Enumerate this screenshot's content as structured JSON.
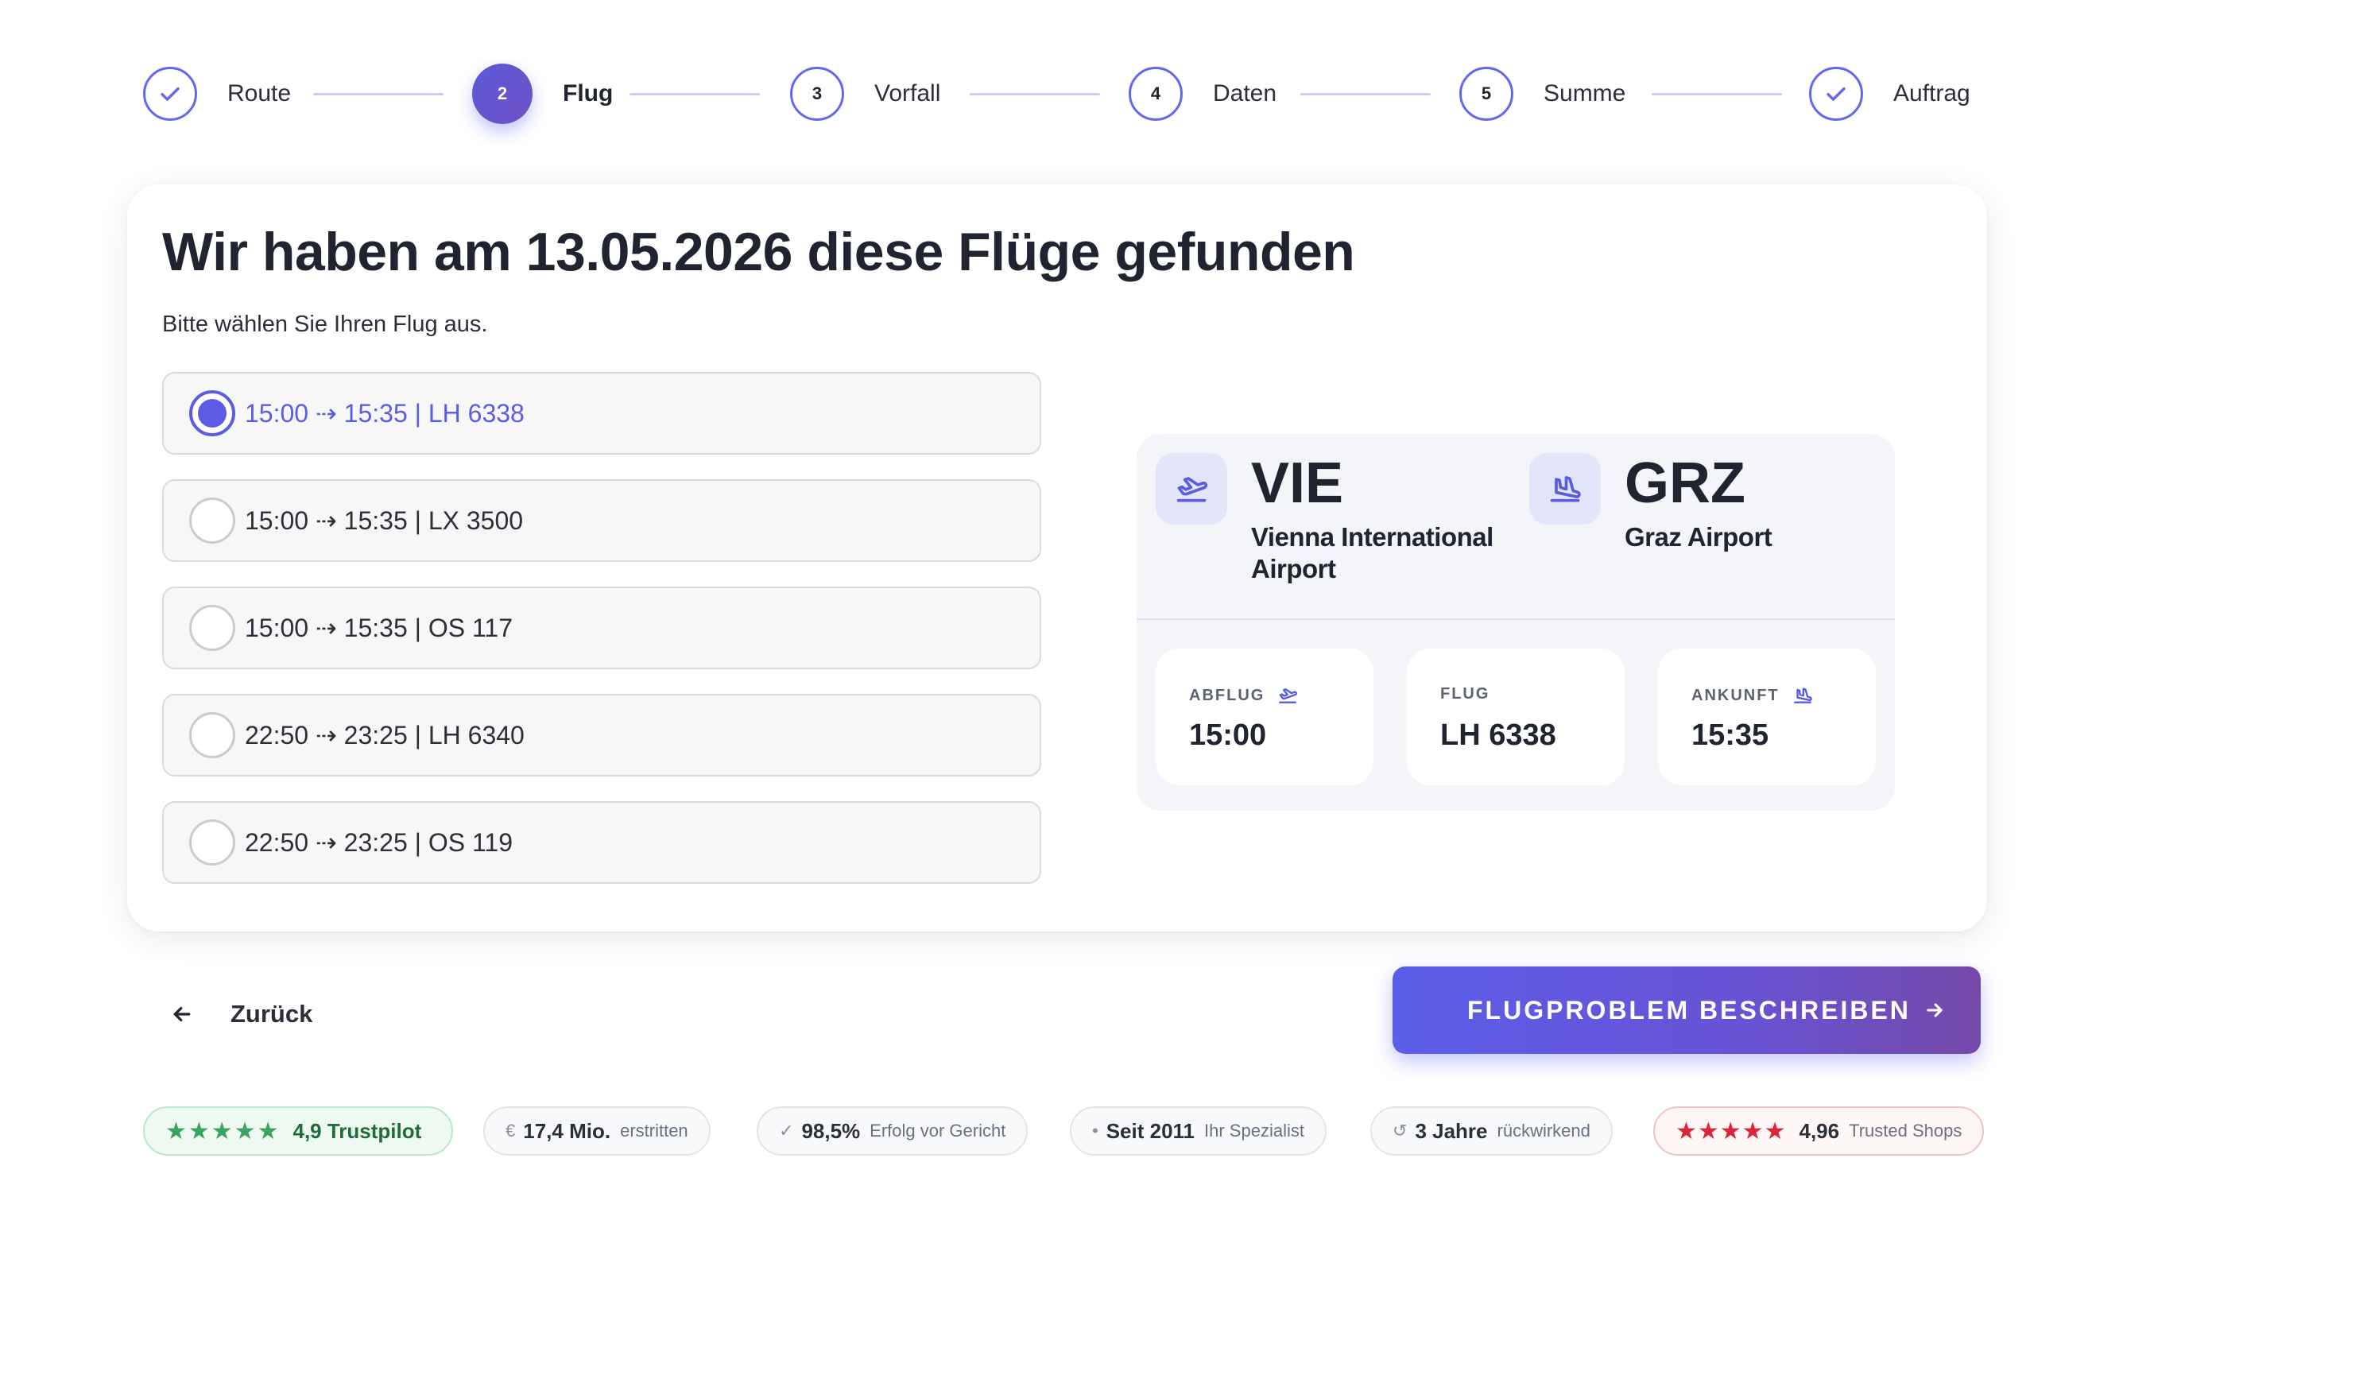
{
  "stepper": {
    "steps": [
      {
        "label": "Route",
        "state": "done",
        "number": ""
      },
      {
        "label": "Flug",
        "state": "active",
        "number": "2"
      },
      {
        "label": "Vorfall",
        "state": "upcoming",
        "number": "3"
      },
      {
        "label": "Daten",
        "state": "upcoming",
        "number": "4"
      },
      {
        "label": "Summe",
        "state": "upcoming",
        "number": "5"
      },
      {
        "label": "Auftrag",
        "state": "done",
        "number": ""
      }
    ]
  },
  "main": {
    "title": "Wir haben am 13.05.2026 diese Flüge gefunden",
    "subtitle": "Bitte wählen Sie Ihren Flug aus.",
    "flights": [
      {
        "label": "15:00 ⇢ 15:35 | LH 6338",
        "selected": true
      },
      {
        "label": "15:00 ⇢ 15:35 | LX 3500",
        "selected": false
      },
      {
        "label": "15:00 ⇢ 15:35 | OS 117",
        "selected": false
      },
      {
        "label": "22:50 ⇢ 23:25 | LH 6340",
        "selected": false
      },
      {
        "label": "22:50 ⇢ 23:25 | OS 119",
        "selected": false
      }
    ]
  },
  "details": {
    "origin": {
      "code": "VIE",
      "name_line1": "Vienna International",
      "name_line2": "Airport"
    },
    "destination": {
      "code": "GRZ",
      "name": "Graz Airport"
    },
    "departure": {
      "label": "ABFLUG",
      "value": "15:00"
    },
    "flight": {
      "label": "FLUG",
      "value": "LH 6338"
    },
    "arrival": {
      "label": "ANKUNFT",
      "value": "15:35"
    }
  },
  "nav": {
    "back_label": "Zurück",
    "cta_label": "FLUGPROBLEM BESCHREIBEN"
  },
  "trust": {
    "trustpilot": {
      "stars": "★★★★★",
      "text": "4,9 Trustpilot"
    },
    "compensation": {
      "icon": "€",
      "strong": "17,4 Mio.",
      "small": "erstritten"
    },
    "success": {
      "icon": "✓",
      "strong": "98,5%",
      "small": "Erfolg vor Gericht"
    },
    "since": {
      "icon": "•",
      "strong": "Seit 2011",
      "small": "Ihr Spezialist"
    },
    "retro": {
      "icon": "↺",
      "strong": "3 Jahre",
      "small": "rückwirkend"
    },
    "shops": {
      "stars": "★★★★★",
      "strong": "4,96",
      "small": "Trusted Shops"
    }
  },
  "colors": {
    "accent": "#5b5ce2",
    "cta_start": "#5a5ee8",
    "cta_end": "#744aa8",
    "trustpilot_green": "#3aa35f",
    "trusted_shops_red": "#d9263b"
  }
}
